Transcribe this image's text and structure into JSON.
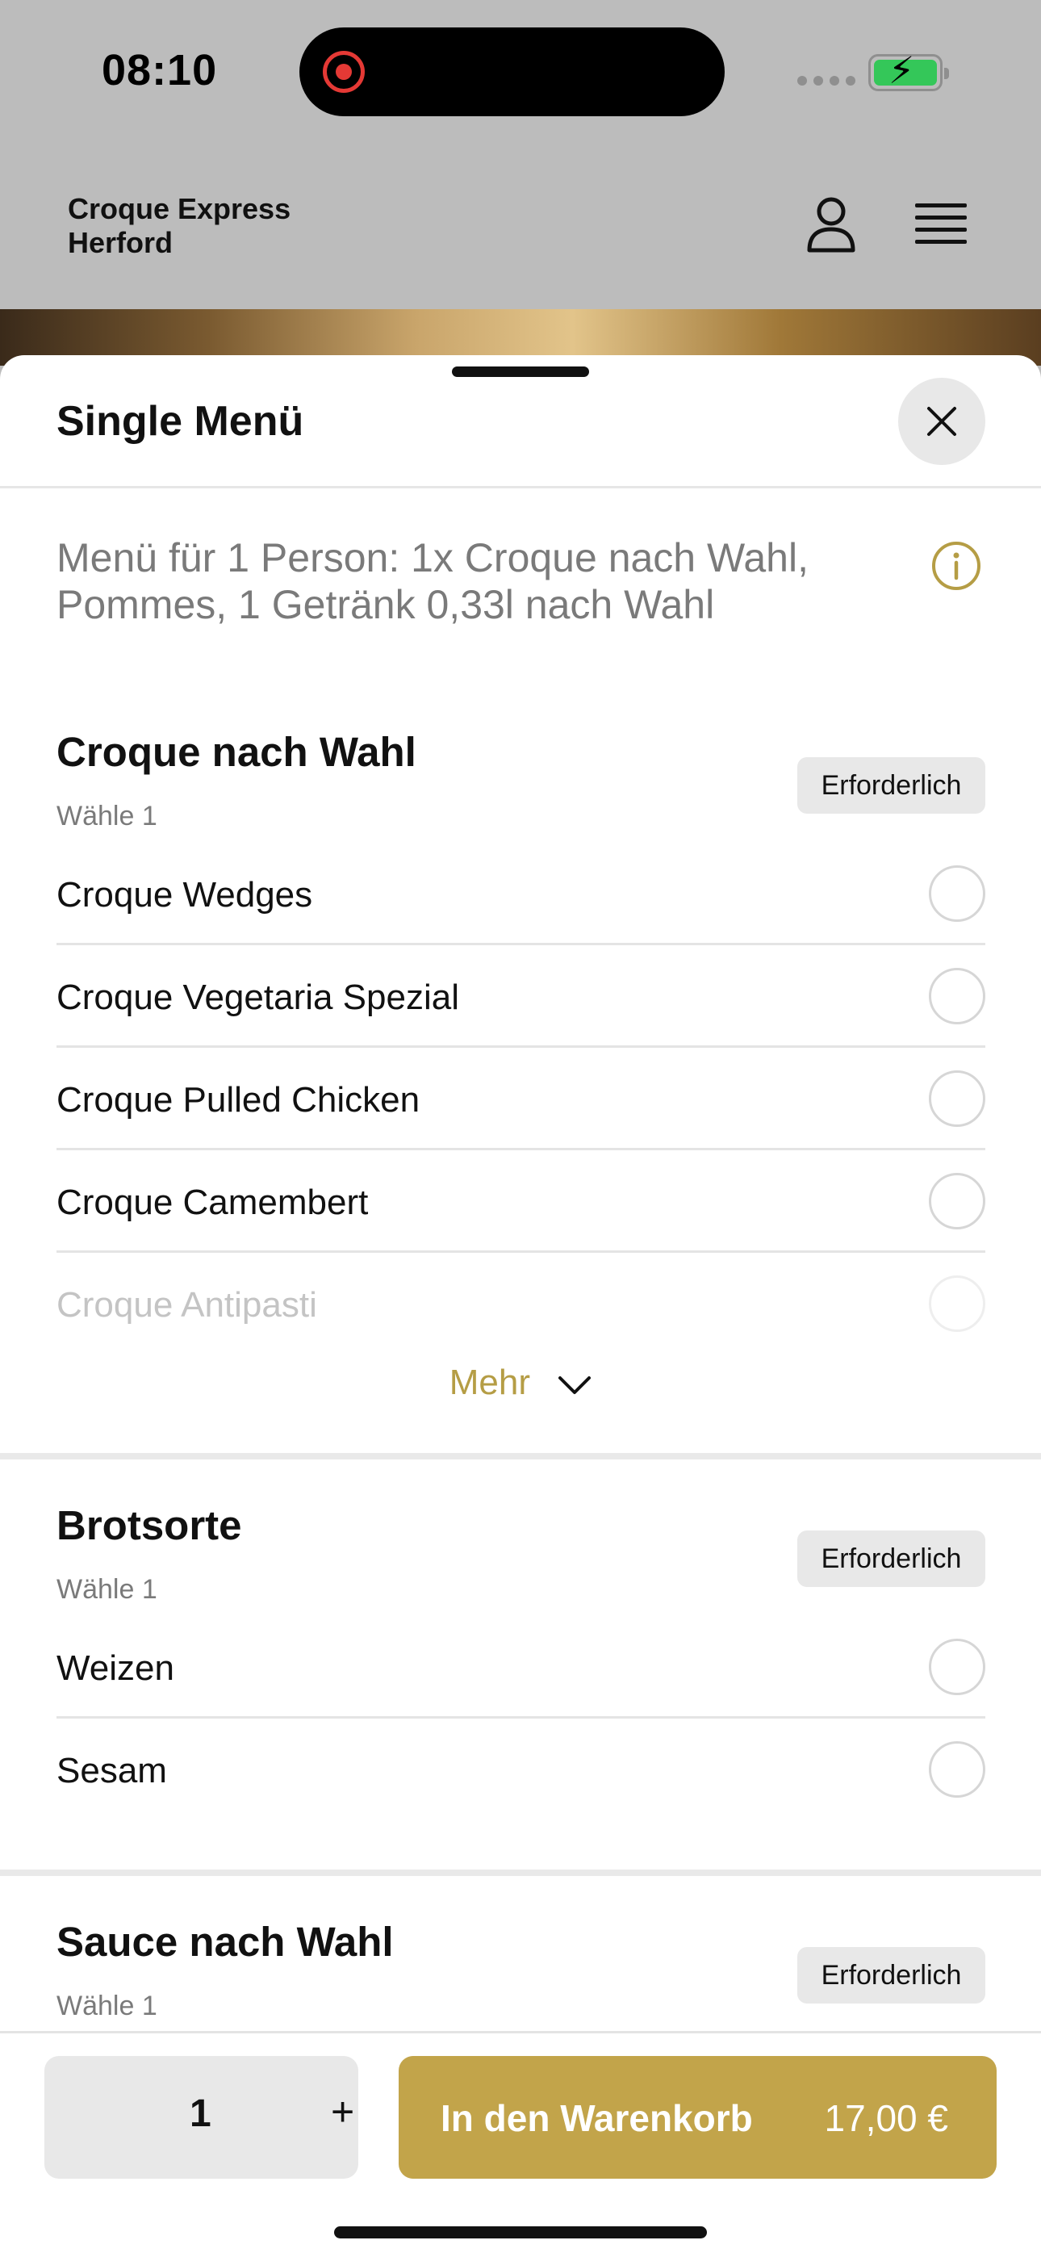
{
  "status_bar": {
    "time": "08:10"
  },
  "header": {
    "store_name_line1": "Croque Express",
    "store_name_line2": "Herford"
  },
  "sheet": {
    "title": "Single Menü",
    "description": "Menü für 1 Person: 1x Croque nach Wahl, Pommes, 1 Getränk 0,33l nach Wahl"
  },
  "groups": [
    {
      "title": "Croque nach Wahl",
      "subtitle": "Wähle 1",
      "badge": "Erforderlich",
      "options": [
        "Croque Wedges",
        "Croque Vegetaria Spezial",
        "Croque Pulled Chicken",
        "Croque Camembert",
        "Croque Antipasti"
      ],
      "more_label": "Mehr"
    },
    {
      "title": "Brotsorte",
      "subtitle": "Wähle 1",
      "badge": "Erforderlich",
      "options": [
        "Weizen",
        "Sesam"
      ]
    },
    {
      "title": "Sauce nach Wahl",
      "subtitle": "Wähle 1",
      "badge": "Erforderlich"
    }
  ],
  "bottom": {
    "quantity": "1",
    "plus": "+",
    "cart_label": "In den Warenkorb",
    "price": "17,00 €"
  },
  "colors": {
    "accent": "#c2a44a",
    "accent_text": "#b59d45"
  }
}
